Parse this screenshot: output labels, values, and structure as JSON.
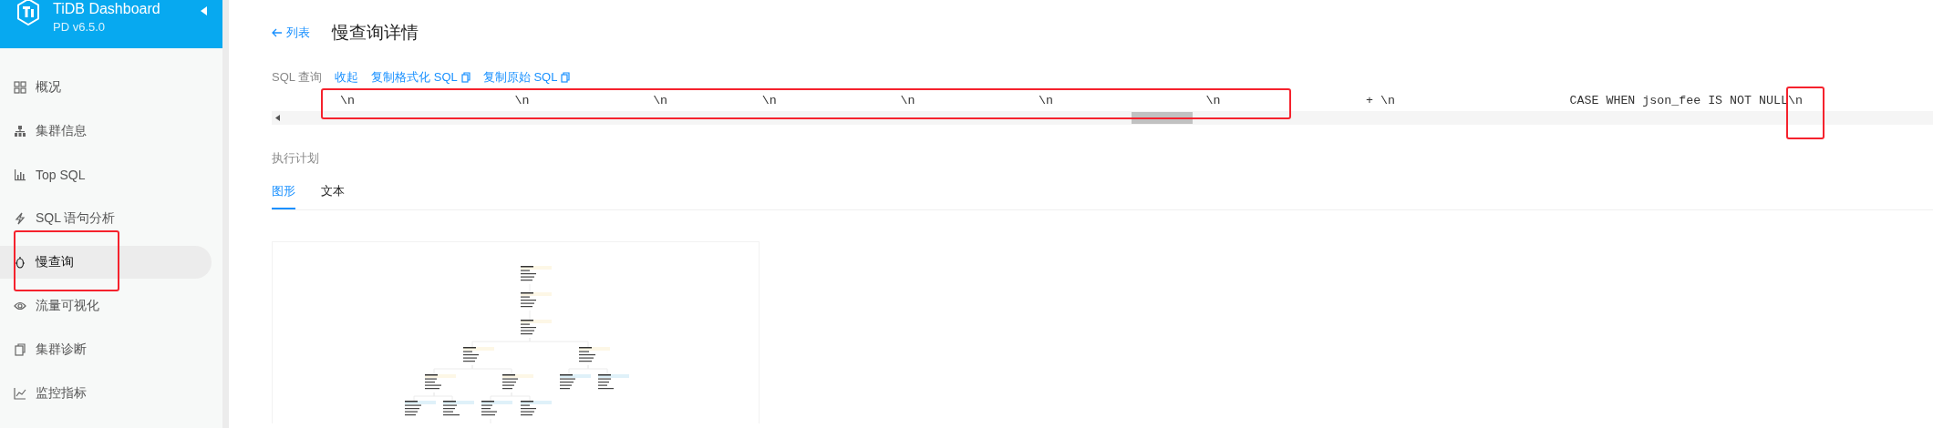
{
  "brand": {
    "title": "TiDB Dashboard",
    "version": "PD v6.5.0"
  },
  "sidebar": {
    "items": [
      {
        "label": "概况",
        "selected": false
      },
      {
        "label": "集群信息",
        "selected": false
      },
      {
        "label": "Top SQL",
        "selected": false
      },
      {
        "label": "SQL 语句分析",
        "selected": false
      },
      {
        "label": "慢查询",
        "selected": true
      },
      {
        "label": "流量可视化",
        "selected": false
      },
      {
        "label": "集群诊断",
        "selected": false
      },
      {
        "label": "监控指标",
        "selected": false
      }
    ]
  },
  "header": {
    "back_link": "列表",
    "title": "慢查询详情"
  },
  "sql": {
    "label": "SQL 查询",
    "actions": [
      {
        "label": "收起",
        "kind": "toggle"
      },
      {
        "label": "复制格式化 SQL",
        "kind": "copy"
      },
      {
        "label": "复制原始 SQL",
        "kind": "copy"
      }
    ],
    "tokens": [
      "\\n",
      "\\n",
      "\\n",
      "\\n",
      "\\n",
      "\\n",
      "\\n",
      "+ \\n",
      "CASE WHEN json_fee IS NOT NULL\\n"
    ]
  },
  "plan": {
    "label": "执行计划",
    "tabs": [
      {
        "label": "图形",
        "selected": true
      },
      {
        "label": "文本",
        "selected": false
      }
    ]
  },
  "annotations": [
    {
      "kind": "sql-line"
    },
    {
      "kind": "sql-end"
    },
    {
      "kind": "menu-item"
    }
  ]
}
